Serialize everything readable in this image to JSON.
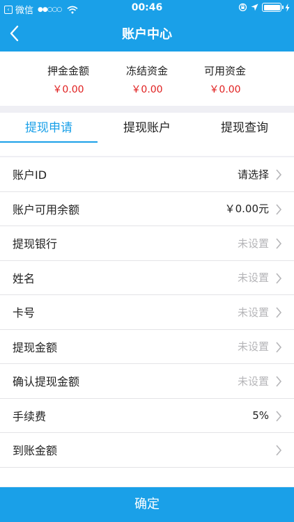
{
  "status_bar": {
    "carrier": "微信",
    "signal": "●●○○○",
    "time": "00:46"
  },
  "nav": {
    "title": "账户中心"
  },
  "funds": [
    {
      "label": "押金金额",
      "value": "￥0.00"
    },
    {
      "label": "冻结资金",
      "value": "￥0.00"
    },
    {
      "label": "可用资金",
      "value": "￥0.00"
    }
  ],
  "tabs": [
    {
      "label": "提现申请",
      "active": true
    },
    {
      "label": "提现账户",
      "active": false
    },
    {
      "label": "提现查询",
      "active": false
    }
  ],
  "form": {
    "rows": [
      {
        "label": "账户ID",
        "value": "请选择",
        "placeholder": false
      },
      {
        "label": "账户可用余额",
        "value": "￥0.00元",
        "placeholder": false
      },
      {
        "label": "提现银行",
        "value": "未设置",
        "placeholder": true
      },
      {
        "label": "姓名",
        "value": "未设置",
        "placeholder": true
      },
      {
        "label": "卡号",
        "value": "未设置",
        "placeholder": true
      },
      {
        "label": "提现金额",
        "value": "未设置",
        "placeholder": true
      },
      {
        "label": "确认提现金额",
        "value": "未设置",
        "placeholder": true
      },
      {
        "label": "手续费",
        "value": "5%",
        "placeholder": false
      },
      {
        "label": "到账金额",
        "value": "",
        "placeholder": false
      }
    ]
  },
  "confirm_button": {
    "label": "确定"
  },
  "colors": {
    "accent": "#1aa0e8",
    "price_red": "#e02020",
    "placeholder_gray": "#b5b5b8"
  }
}
